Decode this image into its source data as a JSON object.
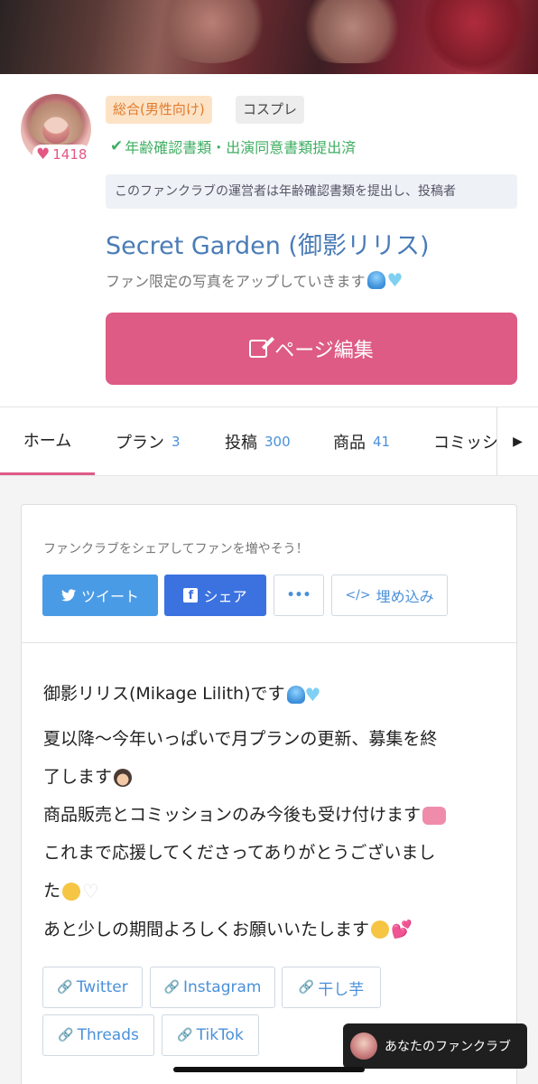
{
  "profile": {
    "likes": "1418",
    "category": "総合(男性向け)",
    "subcategory": "コスプレ",
    "verified": "年齢確認書類・出演同意書類提出済",
    "notice": "このファンクラブの運営者は年齢確認書類を提出し、投稿者",
    "title": "Secret Garden (御影リリス)",
    "description": "ファン限定の写真をアップしていきます",
    "edit_button": "ページ編集"
  },
  "tabs": [
    {
      "label": "ホーム",
      "count": ""
    },
    {
      "label": "プラン",
      "count": "3"
    },
    {
      "label": "投稿",
      "count": "300"
    },
    {
      "label": "商品",
      "count": "41"
    },
    {
      "label": "コミッシ",
      "count": ""
    }
  ],
  "share": {
    "text": "ファンクラブをシェアしてファンを増やそう！",
    "tweet": "ツイート",
    "facebook": "シェア",
    "more": "•••",
    "embed": "埋め込み"
  },
  "about": {
    "line1": "御影リリス(Mikage Lilith)です",
    "line2": "夏以降〜今年いっぱいで月プランの更新、募集を終",
    "line3": "了します",
    "line4": "商品販売とコミッションのみ今後も受け付けます",
    "line5": "これまで応援してくださってありがとうございまし",
    "line6": "た",
    "line7": "あと少しの期間よろしくお願いいたします"
  },
  "links": [
    "Twitter",
    "Instagram",
    "干し芋",
    "Threads",
    "TikTok"
  ],
  "floating": {
    "label": "あなたのファンクラブ"
  },
  "colors": {
    "accent": "#de5b86",
    "link": "#4a90d9",
    "title": "#4a7cb6",
    "verified": "#3fae62"
  }
}
